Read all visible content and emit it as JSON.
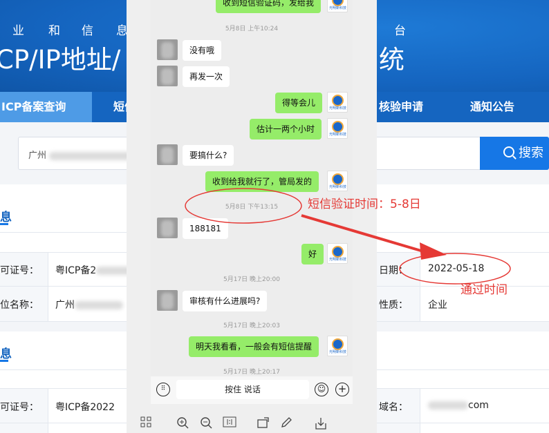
{
  "background_page": {
    "header_subtitle_chars": [
      "业",
      "和",
      "信",
      "息",
      "台"
    ],
    "header_title_left": "CP/IP地址/",
    "header_title_right": "统",
    "nav": [
      {
        "label": "ICP备案查询",
        "active": true
      },
      {
        "label": "短信"
      },
      {
        "label": "核验申请"
      },
      {
        "label": "通知公告"
      }
    ],
    "search": {
      "value_prefix": "广州"
    },
    "search_button": "搜索",
    "section_title_1": "息",
    "section_title_2": "息",
    "rows": [
      {
        "label": "可证号：",
        "value": "粤ICP备2",
        "right_label": "日期：",
        "right_value": "2022-05-18"
      },
      {
        "label": "位名称：",
        "value": "广州",
        "right_label": "性质：",
        "right_value": "企业"
      },
      {
        "label": "可证号：",
        "value": "粤ICP备2022",
        "right_label": "域名：",
        "right_value": "com"
      }
    ]
  },
  "chat": {
    "messages": [
      {
        "side": "right",
        "text": "收到短信验证码，发给我"
      },
      {
        "type": "time",
        "text": "5月8日 上午10:24"
      },
      {
        "side": "left",
        "text": "没有哦"
      },
      {
        "side": "left",
        "text": "再发一次"
      },
      {
        "side": "right",
        "text": "得等会儿"
      },
      {
        "side": "right",
        "text": "估计一两个小时"
      },
      {
        "side": "left",
        "text": "要搞什么?"
      },
      {
        "side": "right",
        "text": "收到给我就行了，管局发的"
      },
      {
        "type": "time",
        "text": "5月8日 下午13:15"
      },
      {
        "side": "left",
        "text": "188181"
      },
      {
        "side": "right",
        "text": "好"
      },
      {
        "type": "time",
        "text": "5月17日 晚上20:00"
      },
      {
        "side": "left",
        "text": "审核有什么进展吗?"
      },
      {
        "type": "time",
        "text": "5月17日 晚上20:03"
      },
      {
        "side": "right",
        "text": "明天我看看，一般会有短信提醒"
      },
      {
        "type": "time",
        "text": "5月17日 晚上20:17"
      }
    ],
    "voice_button": "按住 说话",
    "logo_text": "光明新科技"
  },
  "annotations": {
    "sms_time": "短信验证时间：5-8日",
    "pass_time": "通过时间",
    "color": "#e53935"
  },
  "colors": {
    "header_blue": "#1565c0",
    "nav_active": "#4e9be6",
    "bubble_green": "#95ec69"
  }
}
